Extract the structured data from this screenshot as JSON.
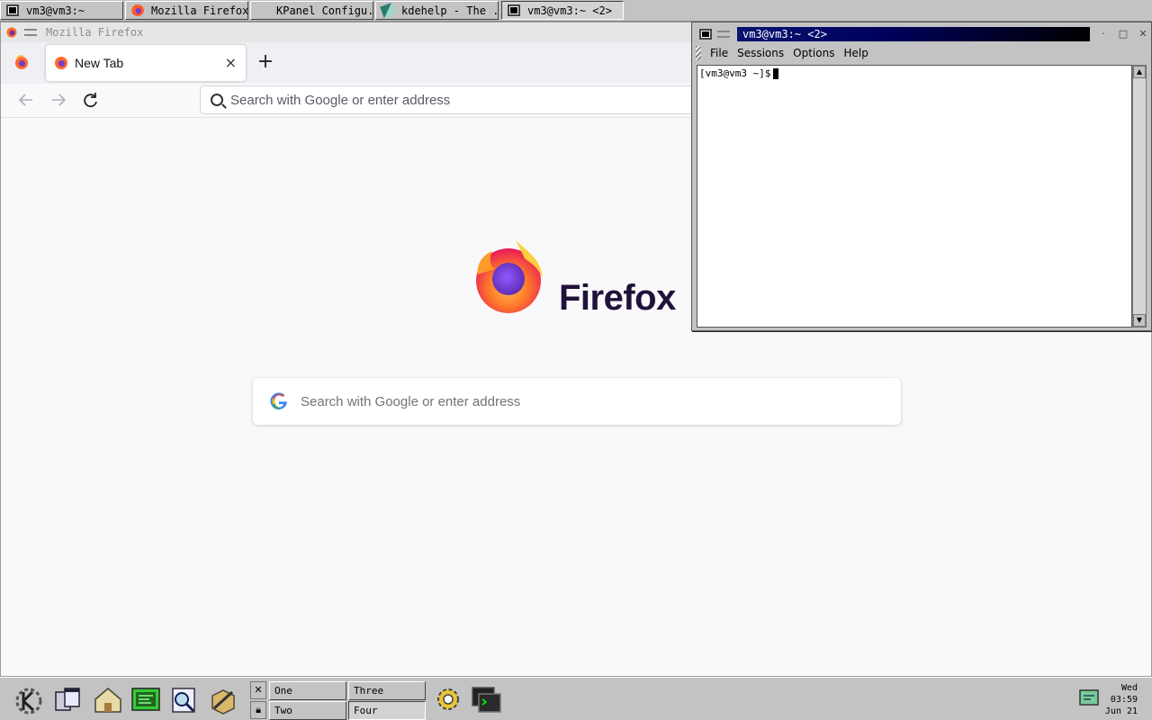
{
  "taskbar": {
    "tasks": [
      {
        "label": "vm3@vm3:~",
        "icon": "terminal-icon",
        "active": false
      },
      {
        "label": "Mozilla Firefox",
        "icon": "firefox-icon",
        "active": false
      },
      {
        "label": "KPanel Configu...",
        "icon": "",
        "active": false
      },
      {
        "label": "kdehelp - The ...",
        "icon": "help-book-icon",
        "active": false
      },
      {
        "label": "vm3@vm3:~ <2>",
        "icon": "terminal-icon",
        "active": true
      }
    ]
  },
  "firefox": {
    "window_title": "Mozilla Firefox",
    "tab_label": "New Tab",
    "tab_close": "×",
    "new_tab": "+",
    "url_placeholder": "Search with Google or enter address",
    "wordmark": "Firefox",
    "search_placeholder": "Search with Google or enter address"
  },
  "konsole": {
    "title": "vm3@vm3:~ <2>",
    "menu": [
      "File",
      "Sessions",
      "Options",
      "Help"
    ],
    "prompt": "[vm3@vm3 ~]$"
  },
  "panel": {
    "desktops": [
      "One",
      "Two",
      "Three",
      "Four"
    ],
    "active_desktop": "Four",
    "clock": {
      "day": "Wed",
      "time": "03:59",
      "date": "Jun 21"
    }
  }
}
